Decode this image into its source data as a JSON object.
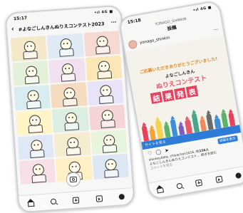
{
  "left_phone": {
    "time": "15:17",
    "signal": "•ıl 4G ■",
    "back_icon": "‹",
    "hashtag": "#よなごしんきんぬりえコンテスト2023",
    "more": "···",
    "nav_icons": [
      "home-icon",
      "search-icon",
      "add-icon",
      "reels-icon",
      "profile-icon"
    ]
  },
  "right_phone": {
    "time": "15:18",
    "signal": "•ıl 4G ■",
    "account_caption": "YONAGO_SHINKIN",
    "page_title": "投稿",
    "username": "yonago_shinkin",
    "more": "···",
    "post": {
      "line1": "ご応募いただきありがとうございました!",
      "line2": "よなごしんきん",
      "line3": "ぬりえコンテスト",
      "banner": [
        "結",
        "果",
        "発",
        "表"
      ]
    },
    "site_link": "サイトを見る",
    "save_button": "詳細を表示",
    "liked_by": "shinkeydata, chisachan1016, 他",
    "likes": "156人",
    "caption_line": "よなごしんきんぬりえコンテスト... 続きを読む",
    "comments_link": "コメントを見る"
  },
  "colors": {
    "accent_pink": "#e35a6b",
    "banner_red": "#e8415d",
    "orange": "#e08a2c",
    "link_blue": "#2f7cd8"
  }
}
